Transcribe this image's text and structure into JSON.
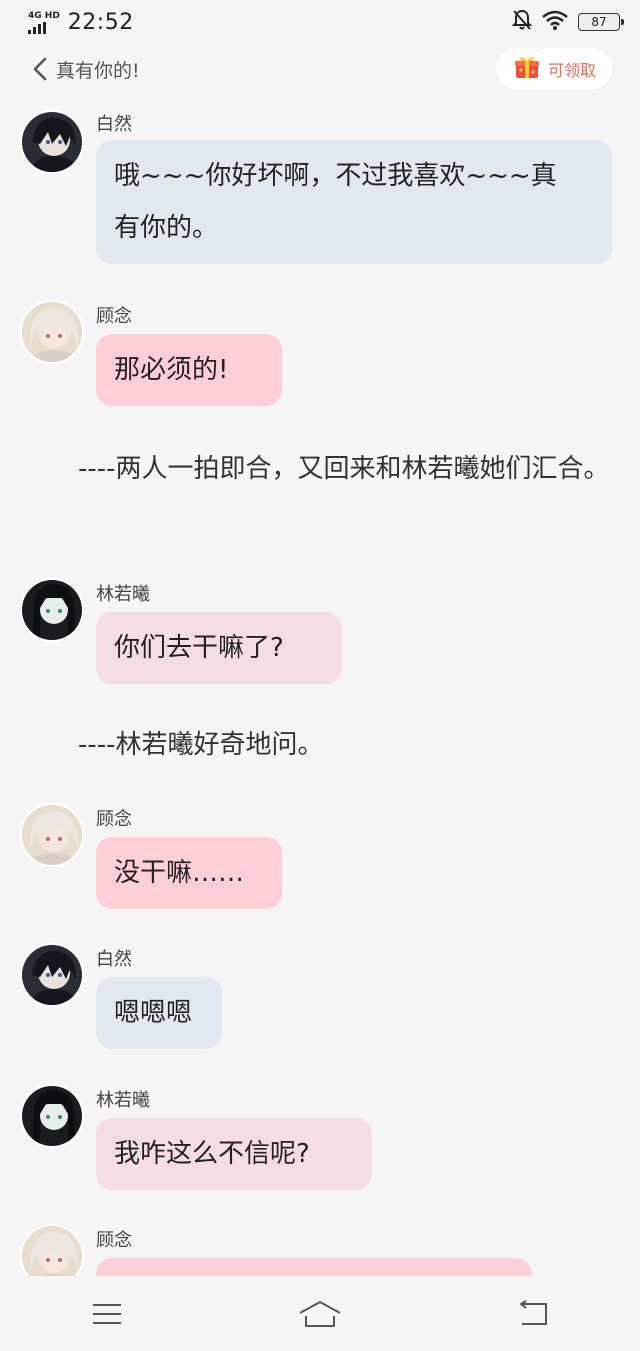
{
  "status_bar": {
    "network": "4G HD",
    "time": "22:52",
    "battery": "87"
  },
  "header": {
    "title": "真有你的!",
    "claim_label": "可领取"
  },
  "messages": [
    {
      "sender": "白然",
      "text_lines": [
        "哦~~~你好坏啊，不过我喜欢~~~真",
        "有你的。"
      ]
    },
    {
      "sender": "顾念",
      "text": "那必须的!"
    },
    {
      "narration": "----两人一拍即合，又回来和林若曦她们汇合。"
    },
    {
      "sender": "林若曦",
      "text": "你们去干嘛了?"
    },
    {
      "narration": "----林若曦好奇地问。"
    },
    {
      "sender": "顾念",
      "text": "没干嘛……"
    },
    {
      "sender": "白然",
      "text": "嗯嗯嗯"
    },
    {
      "sender": "林若曦",
      "text": "我咋这么不信呢?"
    },
    {
      "sender": "顾念",
      "text": ""
    }
  ],
  "nav_bar": {
    "icons": [
      "menu-icon",
      "home-icon",
      "back-icon"
    ]
  },
  "colors": {
    "background": "#f5f5f5",
    "bubble_baiyan": "#e3e7ef",
    "bubble_gunian": "#ffcfd9",
    "bubble_linruoxi": "#f5dde1",
    "accent": "#e0705a"
  }
}
